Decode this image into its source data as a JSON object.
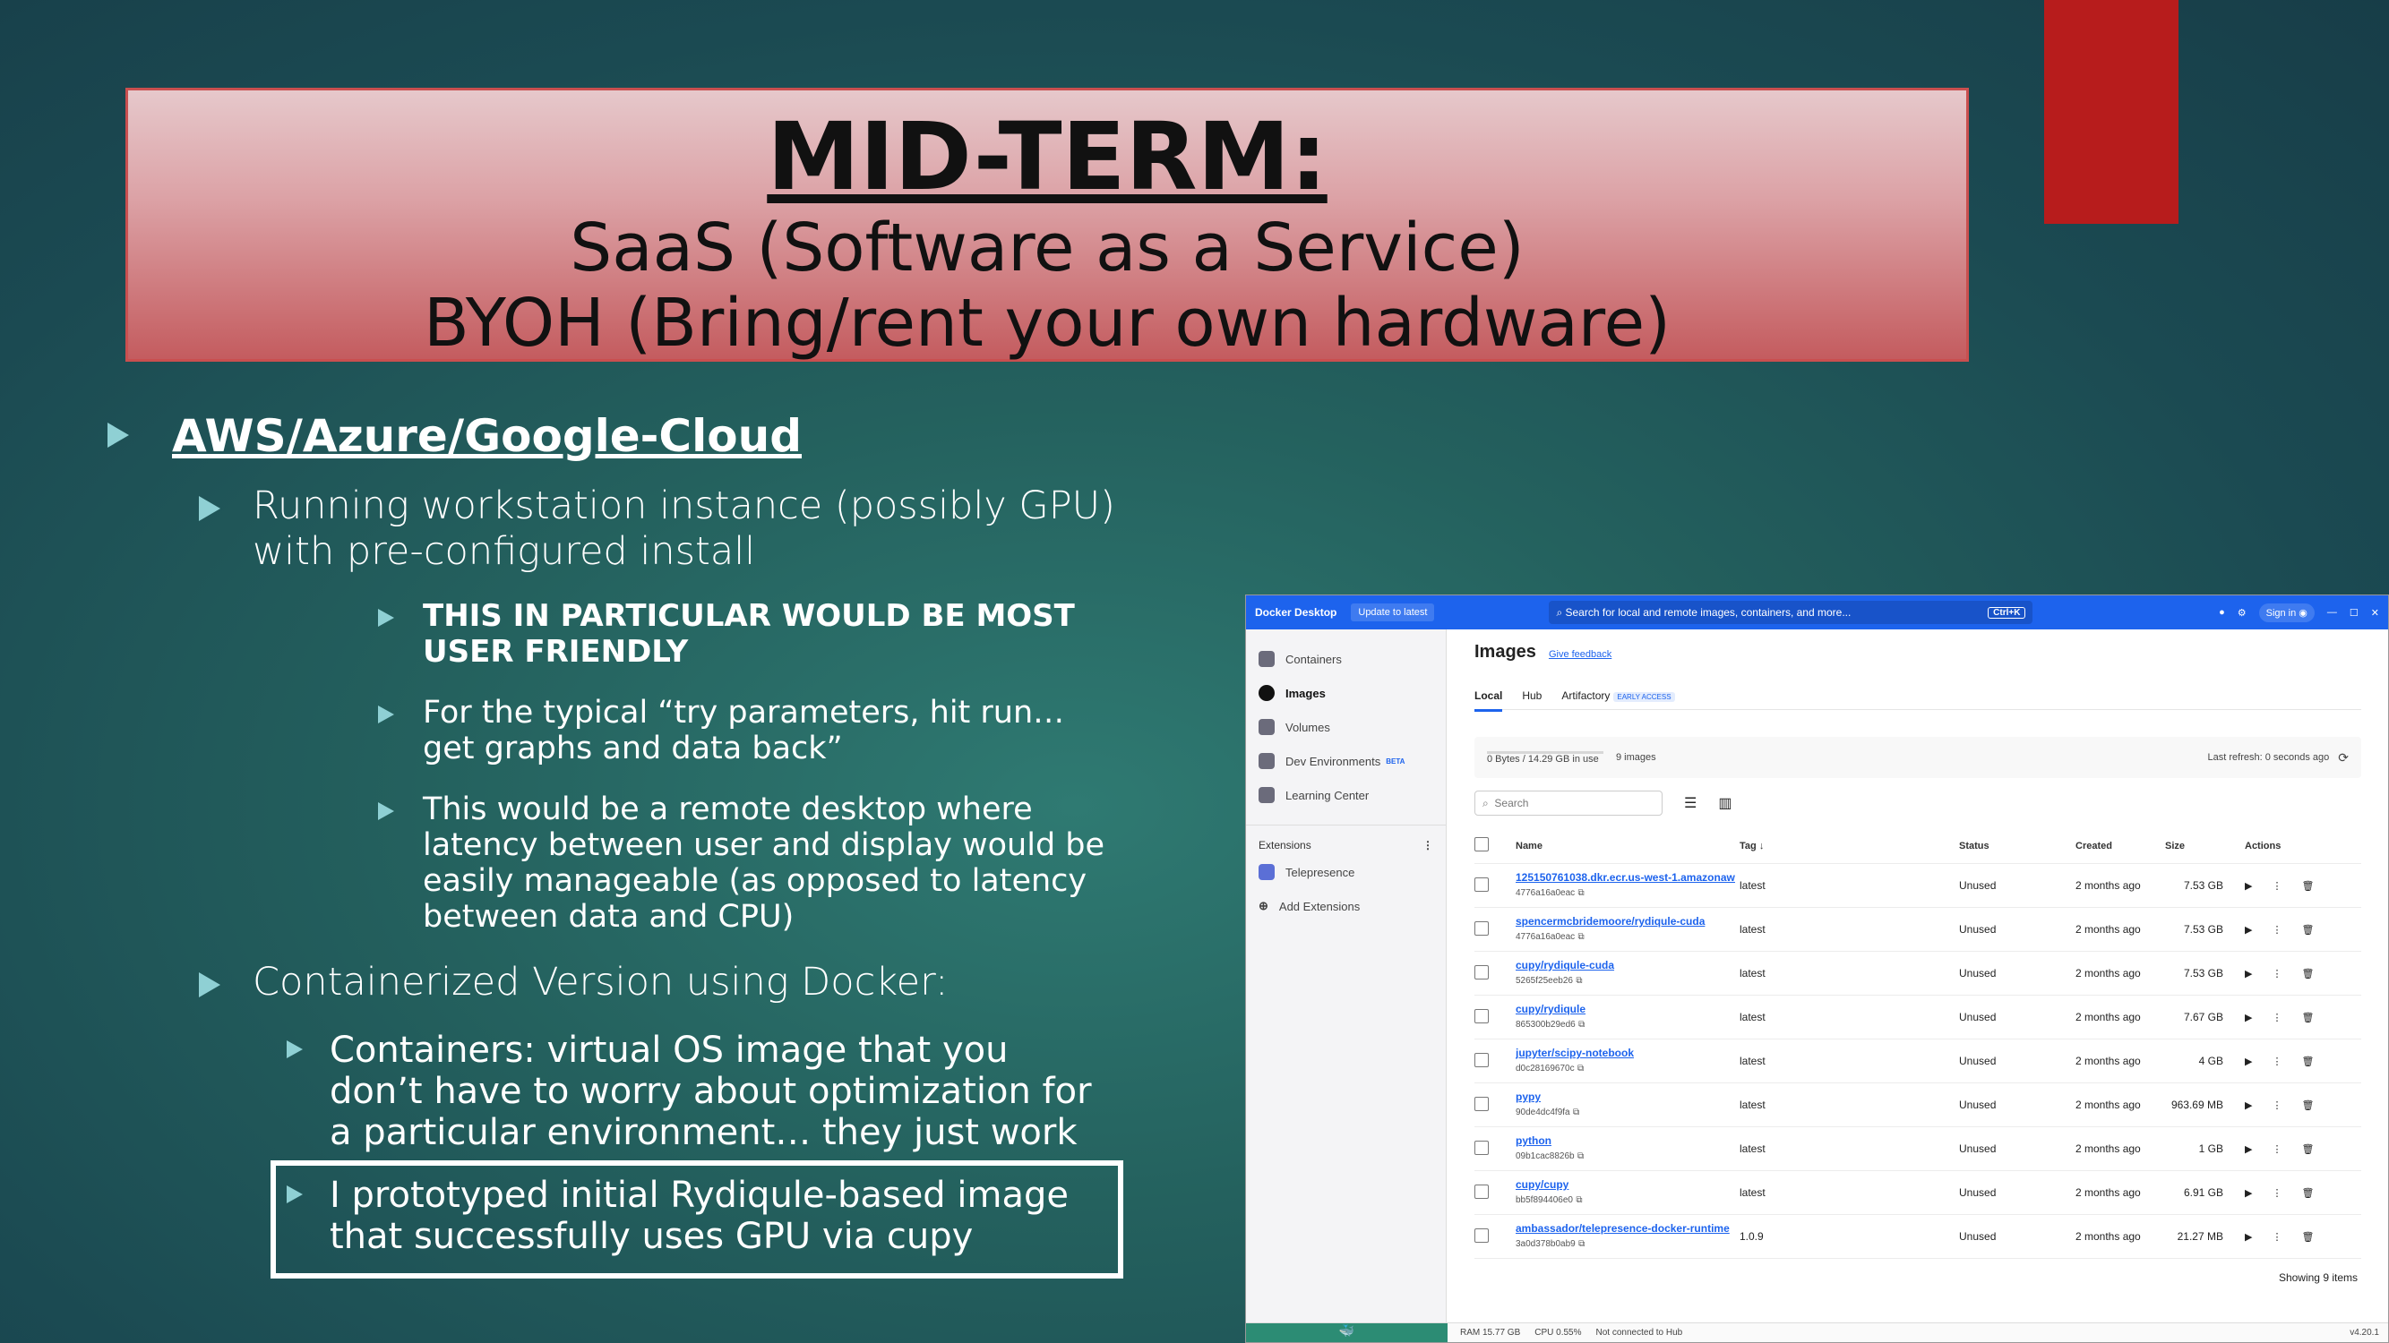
{
  "slide": {
    "title": "MID-TERM:",
    "subtitle1": "SaaS (Software as a Service)",
    "subtitle2": "BYOH (Bring/rent your own hardware)",
    "bullets": {
      "cloud": "AWS/Azure/Google-Cloud",
      "running": "Running workstation instance (possibly GPU) with pre-configured install",
      "friendly": "THIS IN PARTICULAR WOULD BE MOST USER FRIENDLY",
      "typical": "For the typical “try parameters, hit run… get graphs and data back”",
      "remote": "This would be a remote desktop where latency between user and display would be easily manageable (as opposed to latency between data and CPU)",
      "containerized": "Containerized Version using Docker:",
      "containers": "Containers: virtual OS image that you don’t have to worry about optimization for a particular environment… they just work",
      "prototyped": "I prototyped initial Rydiqule-based image that successfully uses GPU via cupy"
    },
    "colors": {
      "accent_red": "#b71c1c",
      "bullet": "#8fd0d4"
    }
  },
  "docker": {
    "brand": "Docker Desktop",
    "update": "Update to latest",
    "search_placeholder": "Search for local and remote images, containers, and more...",
    "shortcut": "Ctrl+K",
    "sign_in": "Sign in",
    "sidebar": [
      "Containers",
      "Images",
      "Volumes",
      "Dev Environments",
      "Learning Center"
    ],
    "beta": "BETA",
    "extensions": "Extensions",
    "telepresence": "Telepresence",
    "add_extensions": "Add Extensions",
    "page_title": "Images",
    "feedback": "Give feedback",
    "tabs": [
      "Local",
      "Hub",
      "Artifactory"
    ],
    "early_access": "EARLY ACCESS",
    "usage": "0 Bytes / 14.29 GB in use",
    "image_count": "9 images",
    "last_refresh": "Last refresh: 0 seconds ago",
    "search_label": "Search",
    "headers": {
      "name": "Name",
      "tag": "Tag",
      "status": "Status",
      "created": "Created",
      "size": "Size",
      "actions": "Actions"
    },
    "rows": [
      {
        "name": "125150761038.dkr.ecr.us-west-1.amazonaws",
        "id": "4776a16a0eac",
        "tag": "latest",
        "status": "Unused",
        "created": "2 months ago",
        "size": "7.53 GB"
      },
      {
        "name": "spencermcbridemoore/rydiqule-cuda",
        "id": "4776a16a0eac",
        "tag": "latest",
        "status": "Unused",
        "created": "2 months ago",
        "size": "7.53 GB"
      },
      {
        "name": "cupy/rydiqule-cuda",
        "id": "5265f25eeb26",
        "tag": "latest",
        "status": "Unused",
        "created": "2 months ago",
        "size": "7.53 GB"
      },
      {
        "name": "cupy/rydiqule",
        "id": "865300b29ed6",
        "tag": "latest",
        "status": "Unused",
        "created": "2 months ago",
        "size": "7.67 GB"
      },
      {
        "name": "jupyter/scipy-notebook",
        "id": "d0c28169670c",
        "tag": "latest",
        "status": "Unused",
        "created": "2 months ago",
        "size": "4 GB"
      },
      {
        "name": "pypy",
        "id": "90de4dc4f9fa",
        "tag": "latest",
        "status": "Unused",
        "created": "2 months ago",
        "size": "963.69 MB"
      },
      {
        "name": "python",
        "id": "09b1cac8826b",
        "tag": "latest",
        "status": "Unused",
        "created": "2 months ago",
        "size": "1 GB"
      },
      {
        "name": "cupy/cupy",
        "id": "bb5f894406e0",
        "tag": "latest",
        "status": "Unused",
        "created": "2 months ago",
        "size": "6.91 GB"
      },
      {
        "name": "ambassador/telepresence-docker-runtime",
        "id": "3a0d378b0ab9",
        "tag": "1.0.9",
        "status": "Unused",
        "created": "2 months ago",
        "size": "21.27 MB"
      }
    ],
    "showing": "Showing 9 items",
    "ram": "RAM 15.77 GB",
    "cpu": "CPU 0.55%",
    "hub": "Not connected to Hub",
    "version": "v4.20.1"
  }
}
